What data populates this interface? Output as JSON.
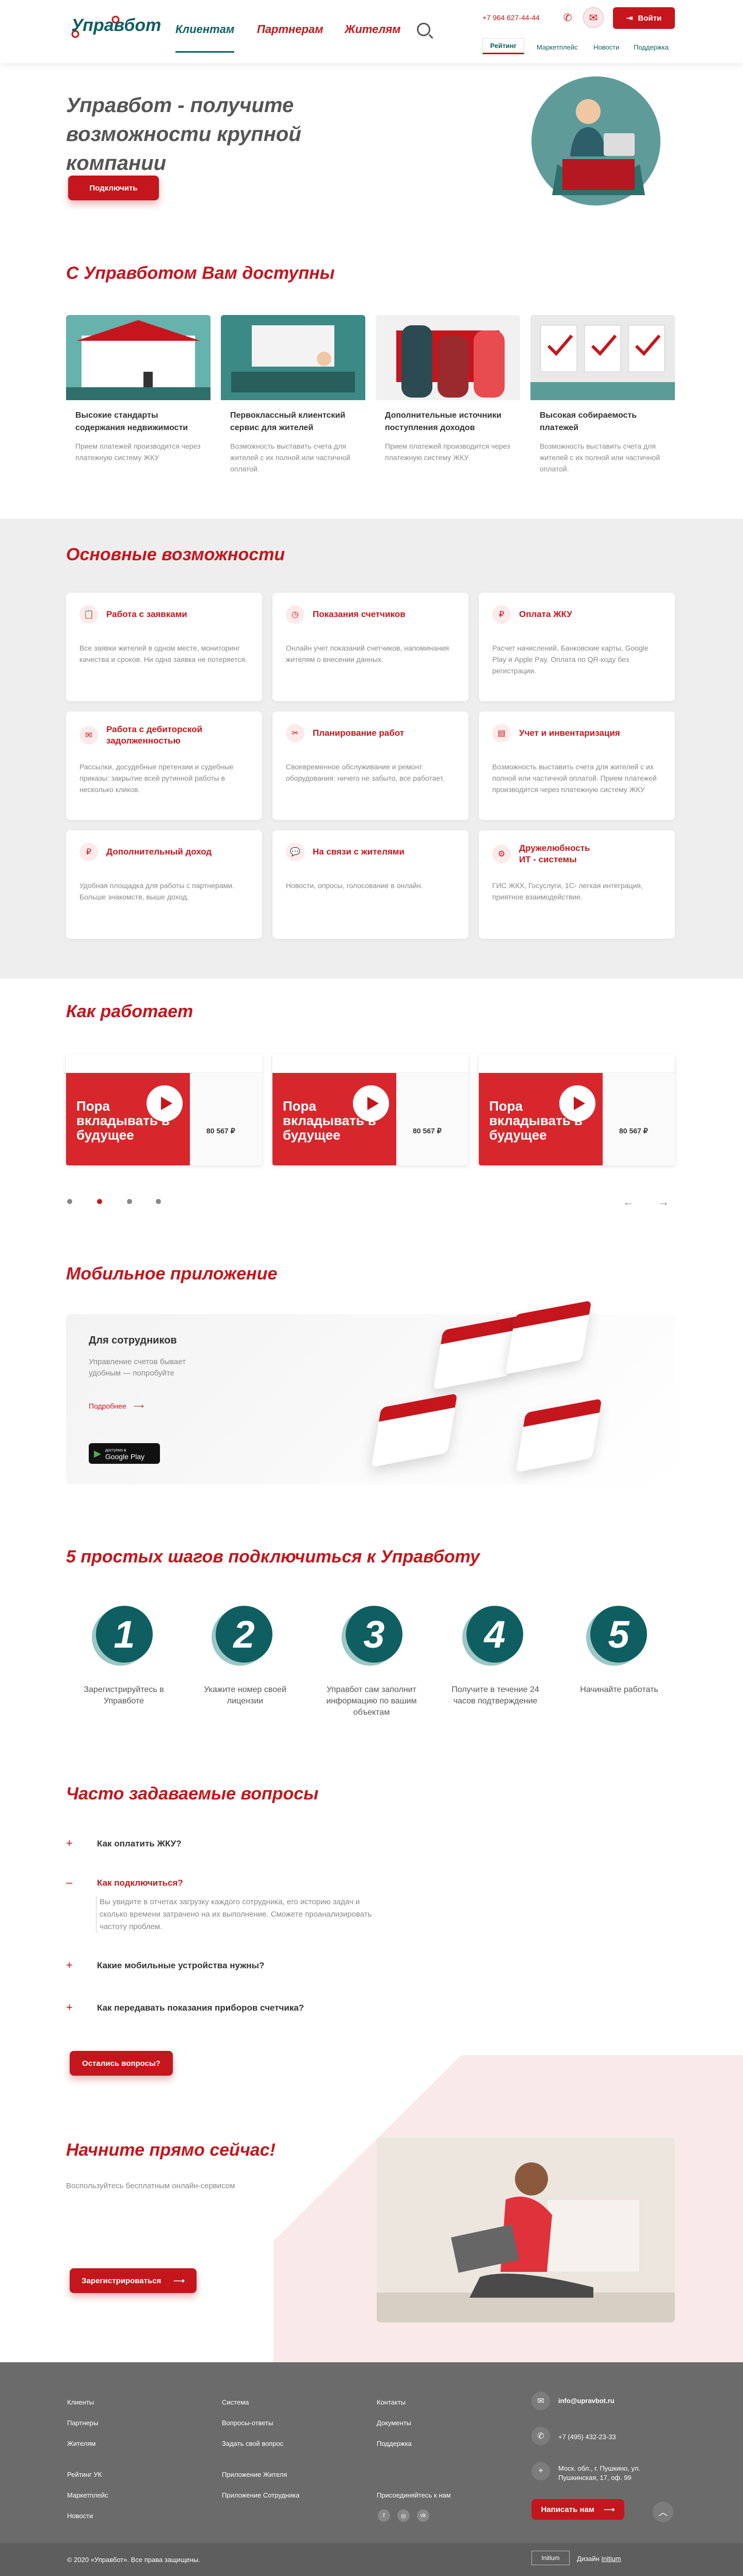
{
  "header": {
    "logo": "Управбот",
    "nav": [
      "Клиентам",
      "Партнерам",
      "Жителям"
    ],
    "phone": "+7 964 627-44-44",
    "login": "Войти",
    "subtabs": [
      "Рейтинг",
      "Маркетплейс",
      "Новости",
      "Поддержка"
    ]
  },
  "hero": {
    "title": "Управбот - получите возможности крупной компании",
    "button": "Подключить"
  },
  "available": {
    "title": "С Управботом Вам доступны",
    "cards": [
      {
        "title": "Высокие стандарты содержания недвижимости",
        "desc": "Прием платежей производится через платежную систему ЖКУ"
      },
      {
        "title": "Первоклассный клиентский сервис для жителей",
        "desc": "Возможность выставить счета для жителей с их полной или частичной оплатой."
      },
      {
        "title": "Дополнительные источники поступления доходов",
        "desc": "Прием платежей производится через платежную систему ЖКУ"
      },
      {
        "title": "Высокая собираемость платежей",
        "desc": "Возможность выставить счета для жителей с их полной или частичной оплатой."
      }
    ]
  },
  "features": {
    "title": "Основные возможности",
    "cards": [
      {
        "title": "Работа с заявками",
        "desc": "Все заявки жителей в одном месте, мониторинг качества и сроков. Ни одна заявка не потеряется.",
        "icon": "📋"
      },
      {
        "title": "Показания счетчиков",
        "desc": "Онлайн учет показаний счетчиков, напоминания жителям о внесении данных.",
        "icon": "◷"
      },
      {
        "title": "Оплата ЖКУ",
        "desc": "Расчет начислений, Банковские карты, Google Play и Apple Pay. Оплата по QR-коду без регистрации.",
        "icon": "₽"
      },
      {
        "title": "Работа с дебиторской задолженностью",
        "desc": "Рассылки, досудебные претензии и судебные приказы: закрытие всей рутинной работы в несколько кликов.",
        "icon": "✉"
      },
      {
        "title": "Планирование работ",
        "desc": "Своевременное обслуживание и ремонт оборудования: ничего не забыто, все работает.",
        "icon": "✂"
      },
      {
        "title": "Учет и инвентаризация",
        "desc": "Возможность выставить счета для жителей с их полной или частичной оплатой. Прием платежей производится через платежную систему ЖКУ",
        "icon": "▤"
      },
      {
        "title": "Дополнительный доход",
        "desc": "Удобная площадка для работы с партнерами. Больше знакомств, выше доход.",
        "icon": "₽"
      },
      {
        "title": "На связи с жителями",
        "desc": "Новости, опросы, голосование в онлайн.",
        "icon": "💬"
      },
      {
        "title": "Дружелюбность ИТ - системы",
        "desc": "ГИС ЖКХ, Госуслуги, 1С- легкая интеграция, приятное взаимодействие.",
        "icon": "⚙"
      }
    ]
  },
  "how": {
    "title": "Как работает",
    "video_text": "Пора вкладывать в будущее",
    "video_num": "80 567 ₽"
  },
  "app": {
    "title": "Мобильное приложение",
    "box_title": "Для сотрудников",
    "box_desc": "Управление счетов бывает удобным — попробуйте",
    "more": "Подробнее",
    "store_small": "доступно в",
    "store": "Google Play"
  },
  "steps": {
    "title": "5 простых шагов подключиться к Управботу",
    "items": [
      {
        "num": "1",
        "text": "Зарегистрируйтесь в Управботе"
      },
      {
        "num": "2",
        "text": "Укажите номер своей лицензии"
      },
      {
        "num": "3",
        "text": "Управбот сам заполнит информацию по вашим объектам"
      },
      {
        "num": "4",
        "text": "Получите в течение 24 часов подтверждение"
      },
      {
        "num": "5",
        "text": "Начинайте работать"
      }
    ]
  },
  "faq": {
    "title": "Часто задаваемые вопросы",
    "items": [
      {
        "q": "Как оплатить ЖКУ?"
      },
      {
        "q": "Как подключиться?"
      },
      {
        "q": "Какие мобильные устройства нужны?"
      },
      {
        "q": "Как передавать показания приборов счетчика?"
      }
    ],
    "answer": "Вы увидите в отчетах загрузку каждого сотрудника, его историю задач и сколько времени затрачено на их выполнение. Сможете проанализировать частоту проблем.",
    "button": "Остались вопросы?"
  },
  "start": {
    "title": "Начните прямо сейчас!",
    "desc": "Воспользуйтесь бесплатным онлайн-сервисом",
    "button": "Зарегистрироваться"
  },
  "footer": {
    "col1": [
      "Клиенты",
      "Партнеры",
      "Жителям"
    ],
    "col1b": [
      "Рейтинг УК",
      "Маркетплейс",
      "Новости"
    ],
    "col2": [
      "Система",
      "Вопросы-ответы",
      "Задать свой вопрос"
    ],
    "col2b": [
      "Приложение Жителя",
      "Приложение Сотрудника"
    ],
    "col3": [
      "Контакты",
      "Документы",
      "Поддержка"
    ],
    "col3b": "Присоединяйтесь к нам",
    "email": "info@upravbot.ru",
    "phone": "+7 (495) 432-23-33",
    "address": "Моск. обл., г. Пушкино, ул. Пушкинская, 17, оф. 99",
    "write": "Написать нам",
    "copyright": "© 2020 «Управбот». Все права защищены.",
    "badge": "Initium",
    "design": "Дизайн",
    "design_link": "Initium"
  },
  "colors": {
    "brand": "#c4161c",
    "teal": "#0f5f62"
  }
}
